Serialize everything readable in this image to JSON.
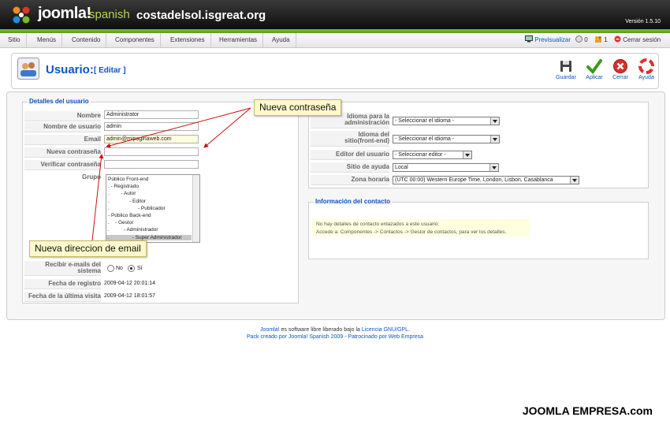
{
  "header": {
    "brand": "joomla!",
    "brand_sub": "spanish",
    "site_name": "costadelsol.isgreat.org",
    "version": "Versión 1.5.10"
  },
  "menu": [
    "Sitio",
    "Menús",
    "Contenido",
    "Componentes",
    "Extensiones",
    "Herramientas",
    "Ayuda"
  ],
  "status": {
    "preview": "Previsualizar",
    "messages": "0",
    "users": "1",
    "logout": "Cerrar sesión"
  },
  "toolbar": {
    "title": "Usuario:",
    "subtitle": "[ Editar ]",
    "buttons": [
      "Guardar",
      "Aplicar",
      "Cerrar",
      "Ayuda"
    ]
  },
  "user_details": {
    "legend": "Detalles del usuario",
    "name_label": "Nombre",
    "name_value": "Administrator",
    "username_label": "Nombre de usuario",
    "username_value": "admin",
    "email_label": "Email",
    "email_value": "admin@mipaginaweb.com",
    "new_password_label": "Nueva contraseña",
    "verify_password_label": "Verificar contraseña",
    "group_label": "Grupo",
    "groups": [
      "Público Front-end",
      ". - Registrado",
      ".        - Autor",
      ".              - Editor",
      ".                    - Publicador",
      "- Público Back-end",
      ".    - Gestor",
      ".          - Administrador",
      ".                - Super Administrador"
    ],
    "selected_group_index": 8,
    "receive_emails_label": [
      "Recibir e-mails del",
      "sistema"
    ],
    "radio_no": "No",
    "radio_yes": "Sí",
    "register_date_label": "Fecha de registro",
    "register_date": "2009-04-12 20:01:14",
    "last_visit_label": "Fecha de la última visita",
    "last_visit": "2009-04-12 18:01:57"
  },
  "parameters": {
    "admin_lang_label": [
      "Idioma para la",
      "administración"
    ],
    "admin_lang_value": "- Seleccionar el idioma -",
    "site_lang_label": [
      "Idioma del",
      "sitio(front-end)"
    ],
    "site_lang_value": "- Seleccionar el idioma -",
    "editor_label": "Editor del usuario",
    "editor_value": "- Seleccionar editor -",
    "help_site_label": "Sitio de ayuda",
    "help_site_value": "Local",
    "timezone_label": "Zona horaria",
    "timezone_value": "(UTC 00:00) Western Europe Time, London, Lisbon, Casablanca"
  },
  "contact": {
    "legend": "Información del contacto",
    "line1": "No hay detalles de contacto enlazados a este usuario:",
    "line2": "Accede a: Componentes -> Contactos -> Gestor de contactos, para ver los detalles."
  },
  "callouts": {
    "password": "Nueva contraseña",
    "email": "Nueva direccion de email"
  },
  "footer": {
    "line1_a": "Joomla!",
    "line1_b": " es software libre liberado bajo la ",
    "line1_c": "Licencia GNU/GPL",
    "line1_d": ".",
    "line2_a": "Pack creado por Joomla! Spanish 2009",
    "line2_b": " - ",
    "line2_c": "Patrocinado por Web Empresa"
  },
  "watermark": "JOOMLA EMPRESA.com",
  "colors": {
    "accent_blue": "#0b55c4",
    "header_green": "#7dbd2f",
    "callout_bg": "#fff8cc"
  }
}
